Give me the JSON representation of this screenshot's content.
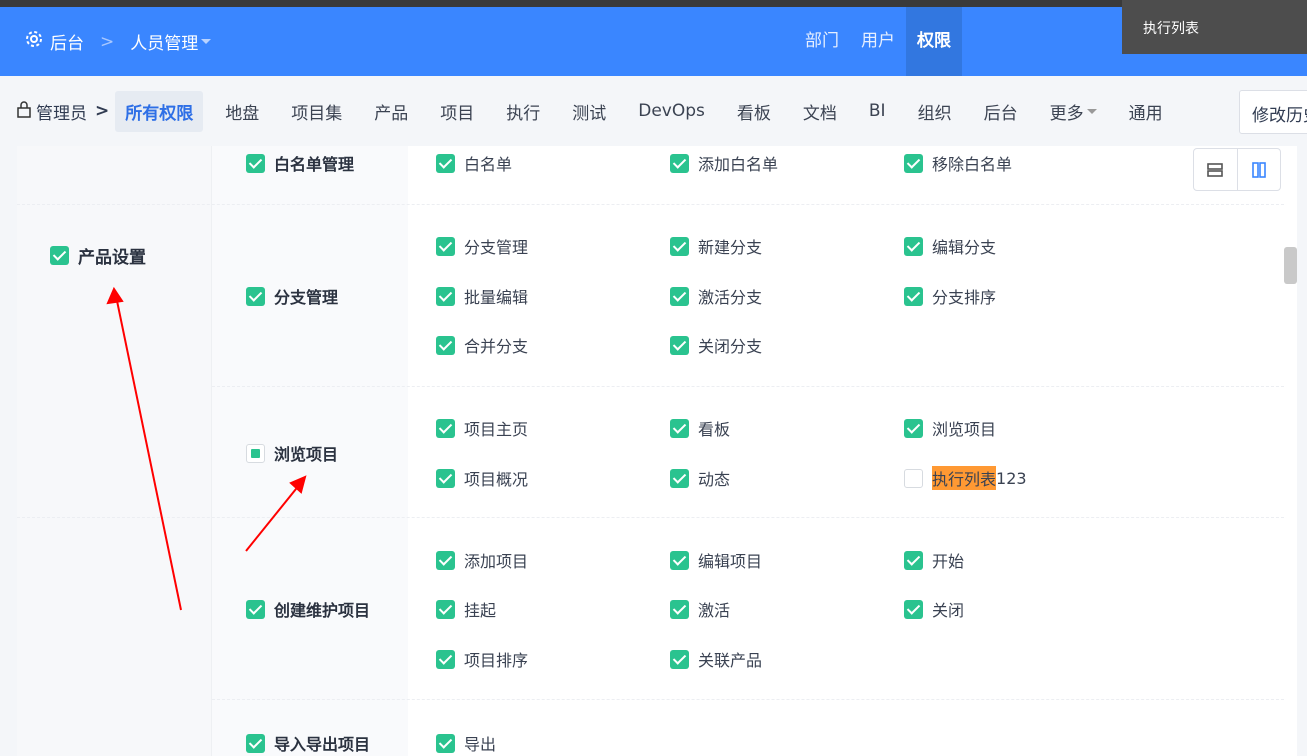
{
  "header": {
    "home_label": "后台",
    "module_label": "人员管理",
    "nav": [
      {
        "label": "部门"
      },
      {
        "label": "用户"
      },
      {
        "label": "权限",
        "active": true
      }
    ]
  },
  "tooltip": "执行列表",
  "tabs": {
    "role": "管理员",
    "items": [
      "所有权限",
      "地盘",
      "项目集",
      "产品",
      "项目",
      "执行",
      "测试",
      "DevOps",
      "看板",
      "文档",
      "BI",
      "组织",
      "后台",
      "更多",
      "通用"
    ],
    "active": "所有权限",
    "history_button": "修改历史"
  },
  "colors": {
    "header": "#3a86ff",
    "checkbox": "#2ac38f",
    "highlight": "#ff9933"
  },
  "module": {
    "label": "产品设置",
    "checked": true
  },
  "groups": [
    {
      "label": "白名单管理",
      "state": "checked",
      "items": [
        {
          "label": "白名单",
          "checked": true
        },
        {
          "label": "添加白名单",
          "checked": true
        },
        {
          "label": "移除白名单",
          "checked": true
        }
      ]
    },
    {
      "label": "分支管理",
      "state": "checked",
      "items": [
        {
          "label": "分支管理",
          "checked": true
        },
        {
          "label": "新建分支",
          "checked": true
        },
        {
          "label": "编辑分支",
          "checked": true
        },
        {
          "label": "批量编辑",
          "checked": true
        },
        {
          "label": "激活分支",
          "checked": true
        },
        {
          "label": "分支排序",
          "checked": true
        },
        {
          "label": "合并分支",
          "checked": true
        },
        {
          "label": "关闭分支",
          "checked": true
        }
      ]
    },
    {
      "label": "浏览项目",
      "state": "indeterminate",
      "items": [
        {
          "label": "项目主页",
          "checked": true
        },
        {
          "label": "看板",
          "checked": true
        },
        {
          "label": "浏览项目",
          "checked": true
        },
        {
          "label": "项目概况",
          "checked": true
        },
        {
          "label": "动态",
          "checked": true
        },
        {
          "label": "执行列表",
          "suffix": "123",
          "checked": false,
          "highlight": true
        }
      ]
    },
    {
      "label": "创建维护项目",
      "state": "checked",
      "items": [
        {
          "label": "添加项目",
          "checked": true
        },
        {
          "label": "编辑项目",
          "checked": true
        },
        {
          "label": "开始",
          "checked": true
        },
        {
          "label": "挂起",
          "checked": true
        },
        {
          "label": "激活",
          "checked": true
        },
        {
          "label": "关闭",
          "checked": true
        },
        {
          "label": "项目排序",
          "checked": true
        },
        {
          "label": "关联产品",
          "checked": true
        }
      ]
    },
    {
      "label": "导入导出项目",
      "state": "checked",
      "items": [
        {
          "label": "导出",
          "checked": true
        }
      ]
    }
  ]
}
